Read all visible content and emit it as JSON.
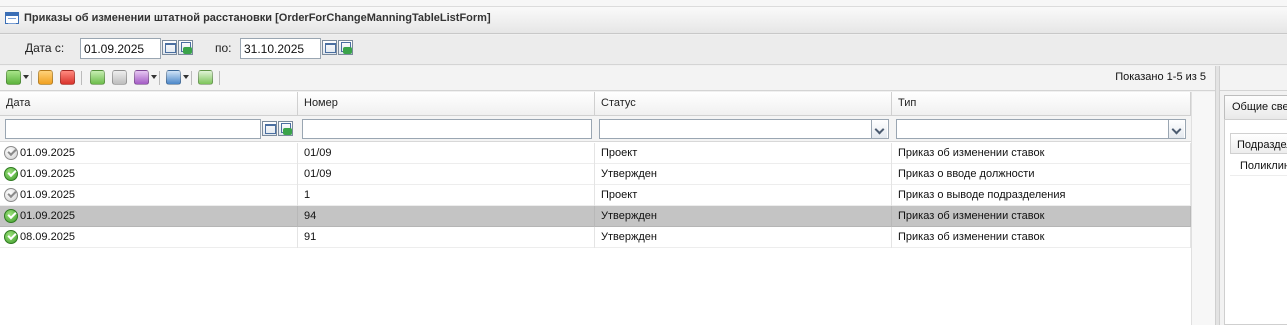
{
  "window": {
    "title": "Приказы об изменении штатной расстановки [OrderForChangeManningTableListForm]"
  },
  "date_filter": {
    "from_label": "Дата с:",
    "from_value": "01.09.2025",
    "to_label": "по:",
    "to_value": "31.10.2025"
  },
  "toolbar": {
    "shown_text": "Показано 1-5 из 5",
    "icons": [
      "add-icon",
      "edit-icon",
      "delete-icon",
      "approve-icon",
      "unapprove-icon",
      "actions-icon",
      "print-icon",
      "refresh-icon"
    ]
  },
  "grid": {
    "columns": [
      "Дата",
      "Номер",
      "Статус",
      "Тип"
    ],
    "rows": [
      {
        "date": "01.09.2025",
        "number": "01/09",
        "status": "Проект",
        "type": "Приказ об изменении ставок",
        "status_icon": "draft",
        "selected": false
      },
      {
        "date": "01.09.2025",
        "number": "01/09",
        "status": "Утвержден",
        "type": "Приказ о вводе должности",
        "status_icon": "approved",
        "selected": false
      },
      {
        "date": "01.09.2025",
        "number": "1",
        "status": "Проект",
        "type": "Приказ о выводе подразделения",
        "status_icon": "draft",
        "selected": false
      },
      {
        "date": "01.09.2025",
        "number": "94",
        "status": "Утвержден",
        "type": "Приказ об изменении ставок",
        "status_icon": "approved",
        "selected": true
      },
      {
        "date": "08.09.2025",
        "number": "91",
        "status": "Утвержден",
        "type": "Приказ об изменении ставок",
        "status_icon": "approved",
        "selected": false
      }
    ]
  },
  "right_panel": {
    "tab_label": "Общие сведения",
    "column_header": "Подразделение",
    "cell_value": "Поликлиника"
  },
  "colors": {
    "selected_row": "#c4c4c4",
    "approved_icon": "#3e9b2b",
    "add_button": "#5cb23c",
    "delete_button": "#d9332b",
    "edit_button": "#f0a020"
  }
}
